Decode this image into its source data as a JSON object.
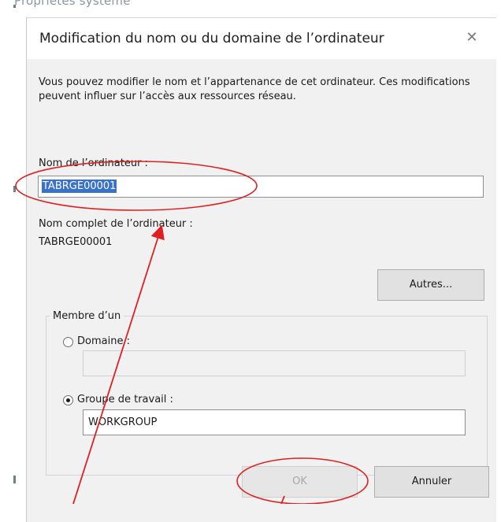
{
  "background": {
    "parent_title": "Propriétés système"
  },
  "dialog": {
    "title": "Modification du nom ou du domaine de l’ordinateur",
    "close_glyph": "✕",
    "description": "Vous pouvez modifier le nom et l’appartenance de cet ordinateur. Ces modifications peuvent influer sur l’accès aux ressources réseau.",
    "computer_name_label": "Nom de l’ordinateur :",
    "computer_name_value": "TABRGE00001",
    "full_name_label": "Nom complet de l’ordinateur :",
    "full_name_value": "TABRGE00001",
    "more_button": "Autres...",
    "member_of": {
      "legend": "Membre d’un",
      "domain_label": "Domaine :",
      "domain_value": "",
      "workgroup_label": "Groupe de travail :",
      "workgroup_value": "WORKGROUP",
      "selected": "workgroup"
    },
    "ok_button": "OK",
    "cancel_button": "Annuler"
  },
  "annotation_color": "#e02020",
  "selection_color": "#3b72c9"
}
